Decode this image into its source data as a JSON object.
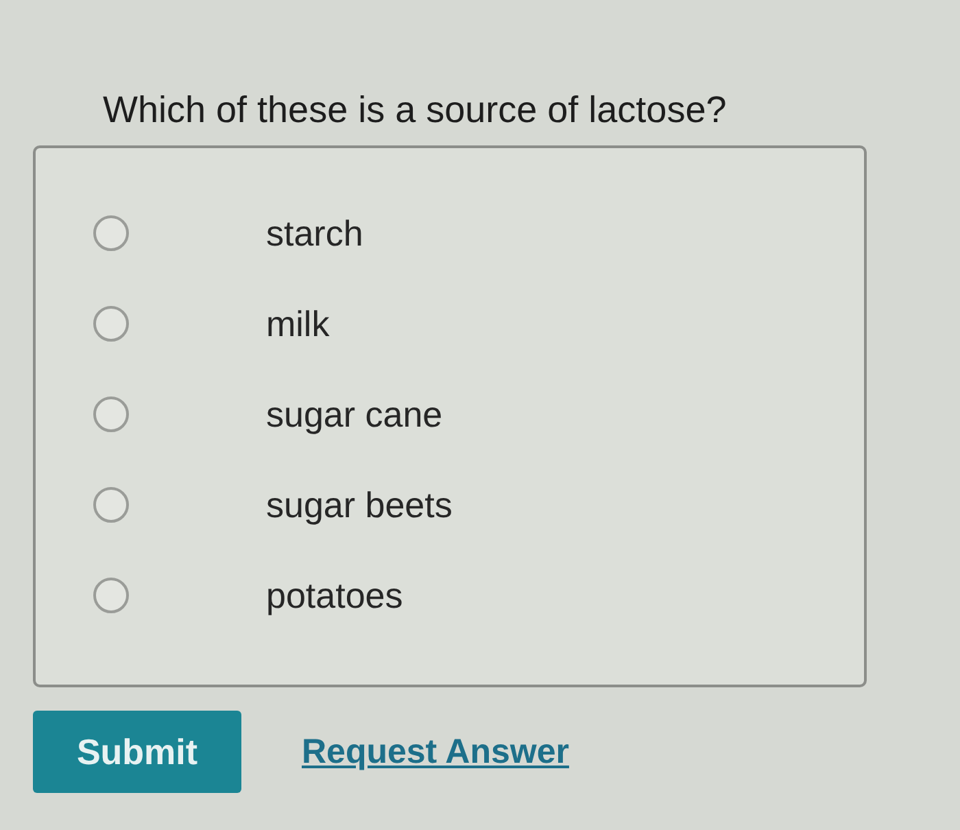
{
  "question": "Which of these is a source of lactose?",
  "options": [
    {
      "label": "starch",
      "selected": false
    },
    {
      "label": "milk",
      "selected": false
    },
    {
      "label": "sugar cane",
      "selected": false
    },
    {
      "label": "sugar beets",
      "selected": false
    },
    {
      "label": "potatoes",
      "selected": false
    }
  ],
  "actions": {
    "submit": "Submit",
    "request_answer": "Request Answer"
  }
}
